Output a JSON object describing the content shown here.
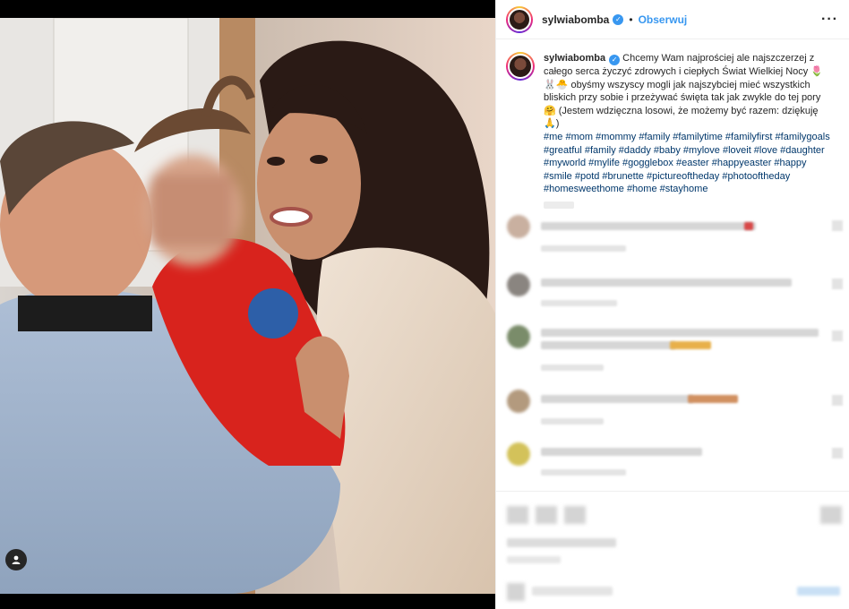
{
  "post": {
    "username": "sylwiabomba",
    "follow_label": "Obserwuj",
    "separator": "•",
    "more_icon": "more-horizontal-icon"
  },
  "caption": {
    "username": "sylwiabomba",
    "text": " Chcemy Wam najprościej ale najszczerzej z całego serca życzyć zdrowych i ciepłych Świat Wielkiej Nocy 🌷🐰🐣 obyśmy wszyscy mogli jak najszybciej mieć wszystkich bliskich przy sobie i przeżywać święta tak jak zwykle do tej pory 🤗 (Jestem wdzięczna losowi, że możemy być razem: dziękuję 🙏)",
    "hashtags": "#me #mom #mommy #family #familytime #familyfirst #familygoals #greatful #family #daddy #baby #mylove #loveit #love #daughter #myworld #mylife #gogglebox #easter #happyeaster #happy #smile #potd #brunette #pictureoftheday #photooftheday #homesweethome #home #stayhome"
  },
  "colors": {
    "accent": "#3897f0",
    "hashtag": "#00376b",
    "text": "#262626",
    "border": "#efefef"
  }
}
